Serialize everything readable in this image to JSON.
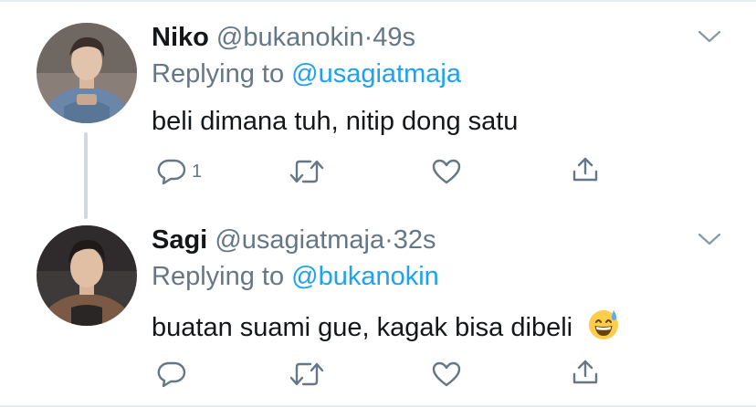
{
  "tweets": [
    {
      "name": "Niko",
      "handle": "@bukanokin",
      "separator": "·",
      "time": "49s",
      "replying_prefix": "Replying to",
      "replying_to": "@usagiatmaja",
      "text": "beli dimana tuh, nitip dong satu",
      "reply_count": "1"
    },
    {
      "name": "Sagi",
      "handle": "@usagiatmaja",
      "separator": "·",
      "time": "32s",
      "replying_prefix": "Replying to",
      "replying_to": "@bukanokin",
      "text": "buatan suami gue, kagak bisa dibeli",
      "reply_count": ""
    }
  ],
  "colors": {
    "link": "#1da1f2",
    "secondary": "#657786",
    "primary": "#14171a",
    "thread_line": "#cfd9de"
  },
  "icons": [
    "reply-icon",
    "retweet-icon",
    "like-icon",
    "share-icon",
    "chevron-down-icon",
    "grinning-sweat-emoji"
  ]
}
